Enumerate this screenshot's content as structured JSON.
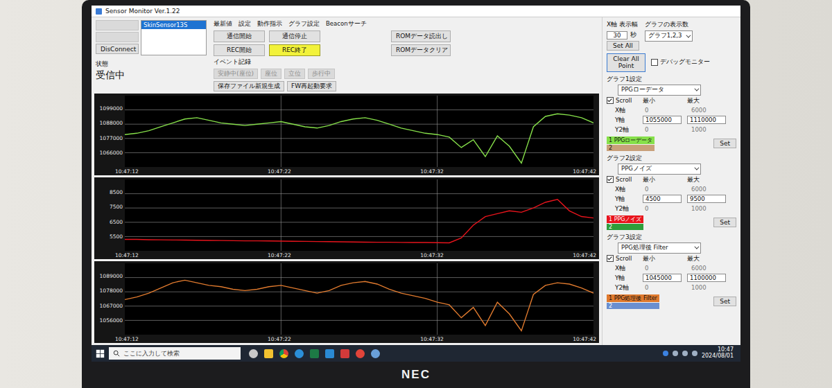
{
  "window": {
    "title": "Sensor Monitor Ver.1.22"
  },
  "connection_buttons": [
    {
      "label": "",
      "disabled": true
    },
    {
      "label": "",
      "disabled": true
    },
    {
      "label": "DisConnect",
      "disabled": false
    }
  ],
  "device_list": [
    {
      "label": "SkinSensor13S",
      "selected": true
    }
  ],
  "status": {
    "label": "状態",
    "value": "受信中"
  },
  "menu": [
    "最新値",
    "設定",
    "動作指示",
    "グラフ設定",
    "Beaconサーチ"
  ],
  "comm_buttons": [
    {
      "label": "通信開始",
      "highlighted": false
    },
    {
      "label": "通信停止",
      "highlighted": false
    }
  ],
  "rec_buttons": [
    {
      "label": "REC開始",
      "highlighted": false
    },
    {
      "label": "REC終了",
      "highlighted": true
    }
  ],
  "rom_buttons": [
    "ROMデータ読出し",
    "ROMデータクリア"
  ],
  "event_record": {
    "label": "イベント記録",
    "buttons": [
      {
        "label": "安静中(座位)",
        "disabled": true
      },
      {
        "label": "座位",
        "disabled": true
      },
      {
        "label": "立位",
        "disabled": true
      },
      {
        "label": "歩行中",
        "disabled": true
      }
    ],
    "actions": [
      "保存ファイル新規生成",
      "FW再起動要求"
    ]
  },
  "display": {
    "x_width_label": "X軸 表示幅",
    "x_width_value": "30",
    "unit": "秒",
    "set_all": "Set All",
    "graph_count_label": "グラフの表示数",
    "graph_count_value": "グラフ1,2,3",
    "clear_button": "Clear All Point",
    "debug": {
      "label": "デバッグモニター",
      "checked": false
    }
  },
  "graphs": [
    {
      "title": "グラフ1設定",
      "source": "PPGローデータ",
      "scroll": {
        "label": "Scroll",
        "checked": true
      },
      "min_label": "最小",
      "max_label": "最大",
      "axes": [
        {
          "label": "X軸",
          "min": "0",
          "max": "6000",
          "editable": false
        },
        {
          "label": "Y軸",
          "min": "1055000",
          "max": "1110000",
          "editable": true
        },
        {
          "label": "Y2軸",
          "min": "0",
          "max": "1000",
          "editable": false
        }
      ],
      "legend": [
        {
          "label": "1 PPGローデータ",
          "color": "#86e04a"
        },
        {
          "label": "2",
          "color": "#c8a07a"
        }
      ],
      "set_button": "Set",
      "chart": {
        "y_ticks": [
          "1099000",
          "1088000",
          "1077000",
          "1066000"
        ],
        "x_ticks": [
          "10:47:12",
          "10:47:22",
          "10:47:32",
          "10:47:42"
        ],
        "values": [
          1080000,
          1081000,
          1083000,
          1086000,
          1089000,
          1092000,
          1093000,
          1091000,
          1089000,
          1088000,
          1087000,
          1088000,
          1089000,
          1090000,
          1088000,
          1086000,
          1085000,
          1087000,
          1090000,
          1092000,
          1093000,
          1091000,
          1088000,
          1085000,
          1083000,
          1081000,
          1080000,
          1078000,
          1070000,
          1076000,
          1063000,
          1079000,
          1071000,
          1058000,
          1086000,
          1094000,
          1096000,
          1095000,
          1093000,
          1089000
        ]
      }
    },
    {
      "title": "グラフ2設定",
      "source": "PPGノイズ",
      "scroll": {
        "label": "Scroll",
        "checked": true
      },
      "min_label": "最小",
      "max_label": "最大",
      "axes": [
        {
          "label": "X軸",
          "min": "0",
          "max": "6000",
          "editable": false
        },
        {
          "label": "Y軸",
          "min": "4500",
          "max": "9500",
          "editable": true
        },
        {
          "label": "Y2軸",
          "min": "0",
          "max": "1000",
          "editable": false
        }
      ],
      "legend": [
        {
          "label": "1 PPGノイズ",
          "color": "#e8141c"
        },
        {
          "label": "2",
          "color": "#2e9e3a"
        }
      ],
      "set_button": "Set",
      "chart": {
        "y_ticks": [
          "8500",
          "7500",
          "6500",
          "5500"
        ],
        "x_ticks": [
          "10:47:12",
          "10:47:22",
          "10:47:32",
          "10:47:42"
        ],
        "values": [
          5300,
          5300,
          5280,
          5270,
          5260,
          5250,
          5240,
          5230,
          5220,
          5210,
          5200,
          5200,
          5190,
          5180,
          5170,
          5160,
          5150,
          5140,
          5130,
          5120,
          5110,
          5100,
          5100,
          5090,
          5080,
          5080,
          5070,
          5060,
          5400,
          6300,
          6900,
          7100,
          7300,
          7200,
          7500,
          7900,
          8100,
          7300,
          6900,
          6800
        ]
      }
    },
    {
      "title": "グラフ3設定",
      "source": "PPG処理後 Filter",
      "scroll": {
        "label": "Scroll",
        "checked": true
      },
      "min_label": "最小",
      "max_label": "最大",
      "axes": [
        {
          "label": "X軸",
          "min": "0",
          "max": "6000",
          "editable": false
        },
        {
          "label": "Y軸",
          "min": "1045000",
          "max": "1100000",
          "editable": true
        },
        {
          "label": "Y2軸",
          "min": "0",
          "max": "1000",
          "editable": false
        }
      ],
      "legend": [
        {
          "label": "1 PPG処理後 Filter",
          "color": "#e07a2e"
        },
        {
          "label": "2",
          "color": "#6a8fd0"
        }
      ],
      "set_button": "Set",
      "chart": {
        "y_ticks": [
          "1089000",
          "1078000",
          "1067000",
          "1056000"
        ],
        "x_ticks": [
          "10:47:12",
          "10:47:22",
          "10:47:32",
          "10:47:42"
        ],
        "values": [
          1072000,
          1074000,
          1077000,
          1081000,
          1085000,
          1087000,
          1085000,
          1083000,
          1082000,
          1080000,
          1079000,
          1080000,
          1082000,
          1083000,
          1081000,
          1079000,
          1077000,
          1079000,
          1083000,
          1085000,
          1086000,
          1084000,
          1080000,
          1077000,
          1075000,
          1073000,
          1070000,
          1068000,
          1058000,
          1066000,
          1052000,
          1070000,
          1061000,
          1048000,
          1076000,
          1083000,
          1085000,
          1084000,
          1081000,
          1077000
        ]
      }
    }
  ],
  "taskbar": {
    "search_placeholder": "ここに入力して検索",
    "time": "10:47",
    "date": "2024/08/01"
  },
  "bezel": {
    "brand": "NEC"
  }
}
